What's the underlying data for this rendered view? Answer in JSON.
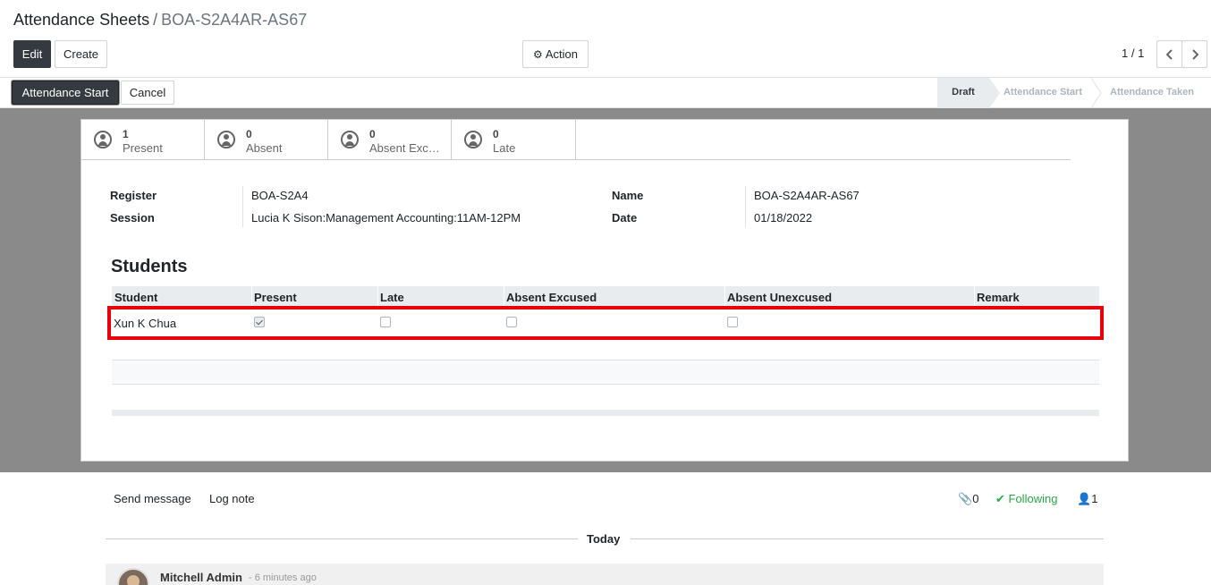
{
  "breadcrumb": {
    "parent": "Attendance Sheets",
    "separator": "/",
    "current": "BOA-S2A4AR-AS67"
  },
  "toolbar": {
    "edit_label": "Edit",
    "create_label": "Create",
    "action_label": "Action",
    "pager": "1 / 1"
  },
  "statusbar": {
    "start_label": "Attendance Start",
    "cancel_label": "Cancel",
    "stages": [
      "Draft",
      "Attendance Start",
      "Attendance Taken"
    ],
    "active_stage": "Draft"
  },
  "stats": [
    {
      "count": "1",
      "label": "Present"
    },
    {
      "count": "0",
      "label": "Absent"
    },
    {
      "count": "0",
      "label": "Absent Exc…"
    },
    {
      "count": "0",
      "label": "Late"
    }
  ],
  "fields": {
    "register_label": "Register",
    "register_value": "BOA-S2A4",
    "session_label": "Session",
    "session_value": "Lucia K Sison:Management Accounting:11AM-12PM",
    "name_label": "Name",
    "name_value": "BOA-S2A4AR-AS67",
    "date_label": "Date",
    "date_value": "01/18/2022"
  },
  "students": {
    "heading": "Students",
    "columns": [
      "Student",
      "Present",
      "Late",
      "Absent Excused",
      "Absent Unexcused",
      "Remark"
    ],
    "rows": [
      {
        "student": "Xun K Chua",
        "present": true,
        "late": false,
        "absent_excused": false,
        "absent_unexcused": false,
        "remark": ""
      }
    ]
  },
  "chatter": {
    "send_message": "Send message",
    "log_note": "Log note",
    "attachments": "0",
    "following": "Following",
    "followers": "1",
    "day": "Today",
    "author": "Mitchell Admin",
    "ago": "- 6 minutes ago"
  },
  "colors": {
    "highlight": "#e8000a",
    "dark_button": "#343a40",
    "following": "#28a745"
  }
}
